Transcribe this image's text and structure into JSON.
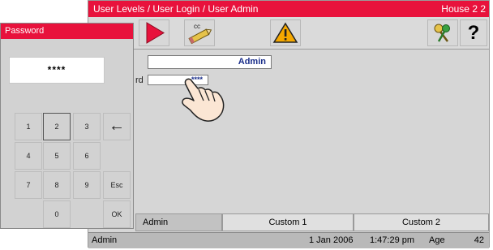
{
  "app": {
    "breadcrumb": "User Levels / User Login / User Admin",
    "house": "House 2 2"
  },
  "toolbar": {
    "cc_label": "cc",
    "help_label": "?"
  },
  "form": {
    "user_label": "",
    "user_value": "Admin",
    "password_label": "rd",
    "password_value": "****"
  },
  "tabs": [
    "Admin",
    "Custom 1",
    "Custom 2"
  ],
  "status": {
    "user": "Admin",
    "date": "1 Jan 2006",
    "time": "1:47:29 pm",
    "age_label": "Age",
    "age_value": "42"
  },
  "password_dialog": {
    "title": "Password",
    "display": "****",
    "keys": [
      "1",
      "2",
      "3",
      "←",
      "4",
      "5",
      "6",
      "7",
      "8",
      "9",
      "Esc",
      "0",
      "OK"
    ]
  },
  "colors": {
    "accent": "#e8123c",
    "panel": "#d6d6d6",
    "status_bar": "#b9b9b9"
  },
  "icons": [
    "play-icon",
    "cc-pencil-icon",
    "warning-icon",
    "keys-icon",
    "help-icon",
    "pointing-hand-icon",
    "backspace-arrow-icon"
  ]
}
